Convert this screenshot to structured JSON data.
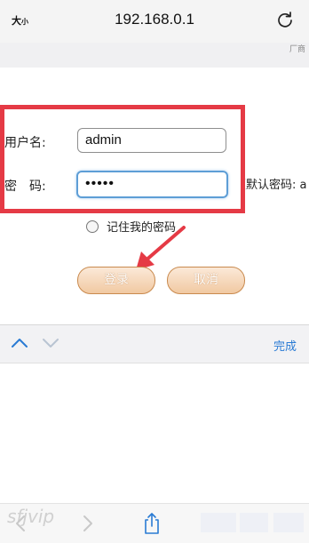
{
  "browser": {
    "text_size_big": "大",
    "text_size_small": "小",
    "url": "192.168.0.1",
    "edge_text": "厂商"
  },
  "form": {
    "username_label": "用户名:",
    "username_value": "admin",
    "password_label": "密　码:",
    "password_masked": "•••••",
    "password_hint": "（默认密码: a",
    "remember_label": "记住我的密码",
    "login_button": "登录",
    "cancel_button": "取消"
  },
  "keyboard_toolbar": {
    "done_label": "完成"
  },
  "bottom": {
    "watermark": "sfjvip"
  },
  "colors": {
    "highlight": "#e53a45",
    "button_fill": "#f1c9a2",
    "focus": "#5e9ed6",
    "done": "#2a7bd4"
  }
}
